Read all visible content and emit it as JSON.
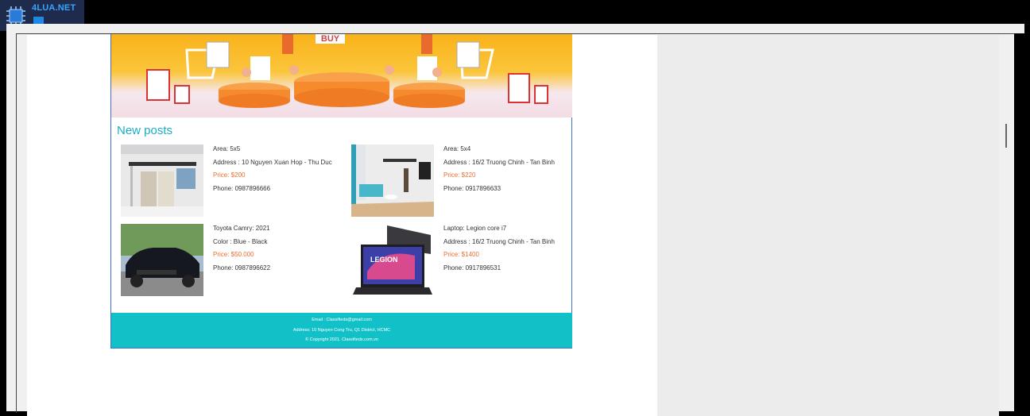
{
  "logo": {
    "brand": "4LUA.NET"
  },
  "banner": {
    "buy_label": "BUY"
  },
  "section_title": "New posts",
  "posts": [
    {
      "line1": "Area: 5x5",
      "line2": "Address : 10 Nguyen Xuan Hop - Thu Duc",
      "price": "Price: $200",
      "phone": "Phone: 0987896666"
    },
    {
      "line1": "Area: 5x4",
      "line2": "Address : 16/2 Truong Chinh - Tan Binh",
      "price": "Price: $220",
      "phone": "Phone: 0917896633"
    },
    {
      "line1": "Toyota Camry: 2021",
      "line2": "Color : Blue - Black",
      "price": "Price: $50.000",
      "phone": "Phone: 0987896622"
    },
    {
      "line1": "Laptop: Legion core i7",
      "line2": "Address : 16/2 Truong Chinh - Tan Binh",
      "price": "Price: $1400",
      "phone": "Phone: 0917896531"
    }
  ],
  "laptop_brand": "LEGION",
  "footer": {
    "email": "Email : Classifieds@gmail.com",
    "address": "Address: 10 Nguyen Cong Tru, Q1 District, HCMC",
    "copyright": "© Copyright 2021. Classifieds.com.vn"
  },
  "colors": {
    "accent": "#18aec5",
    "price": "#ef6c2e",
    "footer_bg": "#12c1c8",
    "border": "#3d6fd1"
  }
}
